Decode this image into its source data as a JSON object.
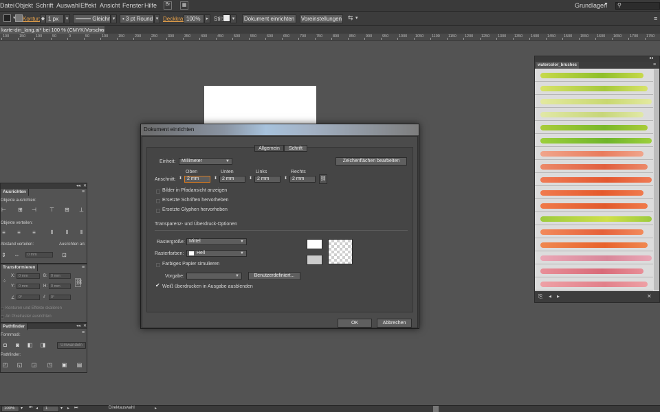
{
  "menu": [
    "Datei",
    "Objekt",
    "Schrift",
    "Auswahl",
    "Effekt",
    "Ansicht",
    "Fenster",
    "Hilfe"
  ],
  "workspace": "Grundlagen",
  "control": {
    "kontur_label": "Kontur:",
    "stroke_weight": "1 px",
    "stroke_style": "Gleichm.",
    "brush": "3 pt Round",
    "deckkraft_label": "Deckkraft:",
    "deckkraft_value": "100%",
    "stil_label": "Stil:",
    "doc_setup_button": "Dokument einrichten",
    "prefs_button": "Voreinstellungen"
  },
  "doc_tab": "karte-din_lang.ai* bei 100 % (CMYK/Vorschau)",
  "ruler": [
    "100",
    "150",
    "100",
    "50",
    "0",
    "50",
    "100",
    "150",
    "200",
    "250",
    "300",
    "350",
    "400",
    "450",
    "500",
    "550",
    "600",
    "650",
    "700",
    "750",
    "800",
    "850",
    "900",
    "950",
    "1000",
    "1050",
    "1100",
    "1150",
    "1200",
    "1250",
    "1300",
    "1350",
    "1400",
    "1450",
    "1500",
    "1550",
    "1600",
    "1650",
    "1700",
    "1750"
  ],
  "align_panel": {
    "tab": "Ausrichten",
    "objects_align": "Objekte ausrichten:",
    "objects_distribute": "Objekte verteilen:",
    "spacing": "Abstand verteilen:",
    "align_to": "Ausrichten an:",
    "spacing_value": "0 mm"
  },
  "transform_panel": {
    "tab": "Transformieren",
    "x": "0 mm",
    "y": "0 mm",
    "b": "0 mm",
    "h": "0 mm",
    "angle": "0°",
    "shear": "0°",
    "scale_strokes": "Konturen und Effekte skalieren",
    "pixel_align": "An Pixelraster ausrichten"
  },
  "pathfinder_panel": {
    "tab": "Pathfinder",
    "form_modes": "Formmodi:",
    "pathfinder": "Pathfinder:",
    "expand": "Umwandeln"
  },
  "dialog": {
    "title": "Dokument einrichten",
    "tabs": [
      "Allgemein",
      "Schrift"
    ],
    "einheit_label": "Einheit:",
    "einheit_value": "Millimeter",
    "edit_artboards": "Zeichenflächen bearbeiten",
    "bleed_label": "Anschnitt:",
    "bleed_headers": [
      "Oben",
      "Unten",
      "Links",
      "Rechts"
    ],
    "bleed_values": [
      "2 mm",
      "2 mm",
      "2 mm",
      "2 mm"
    ],
    "cb_images": "Bilder in Pfadansicht anzeigen",
    "cb_fonts": "Ersetzte Schriften hervorheben",
    "cb_glyphs": "Ersetzte Glyphen hervorheben",
    "section_transparency": "Transparenz- und Überdruck-Optionen",
    "grid_size_label": "Rastergröße:",
    "grid_size_value": "Mittel",
    "grid_colors_label": "Rasterfarben:",
    "grid_colors_value": "Hell",
    "cb_paper": "Farbiges Papier simulieren",
    "preset_label": "Vorgabe:",
    "preset_value": "",
    "custom_button": "Benutzerdefiniert...",
    "cb_overprint": "Weiß überdrucken in Ausgabe ausblenden",
    "overprint_checked": true,
    "ok": "OK",
    "cancel": "Abbrechen"
  },
  "brushes_panel": {
    "tab": "watercolor_brushes",
    "strokes": [
      {
        "c1": "#c7d94a",
        "c2": "#8fbf2a"
      },
      {
        "c1": "#d8e36a",
        "c2": "#a6c93a"
      },
      {
        "c1": "#e3e9a0",
        "c2": "#c9d870"
      },
      {
        "c1": "#e1e8a6",
        "c2": "#c7d67a"
      },
      {
        "c1": "#a9cc3a",
        "c2": "#7ab82a"
      },
      {
        "c1": "#9ccf3c",
        "c2": "#6fb52a"
      },
      {
        "c1": "#f0a58c",
        "c2": "#e97c5c"
      },
      {
        "c1": "#ec8a6a",
        "c2": "#e15f3e"
      },
      {
        "c1": "#ef7a55",
        "c2": "#e4582f"
      },
      {
        "c1": "#f07b4e",
        "c2": "#e55a2c"
      },
      {
        "c1": "#f07a49",
        "c2": "#e25a2c"
      },
      {
        "c1": "#9dcb3e",
        "c2": "#cfe04a"
      },
      {
        "c1": "#f28a5a",
        "c2": "#e6613a"
      },
      {
        "c1": "#f08850",
        "c2": "#e8622c"
      },
      {
        "c1": "#eaa7b6",
        "c2": "#d9879a"
      },
      {
        "c1": "#e88f98",
        "c2": "#d96a78"
      },
      {
        "c1": "#eea0a5",
        "c2": "#e2808a"
      }
    ]
  },
  "status": {
    "zoom": "100%",
    "page": "1",
    "tool": "Direktauswahl"
  }
}
